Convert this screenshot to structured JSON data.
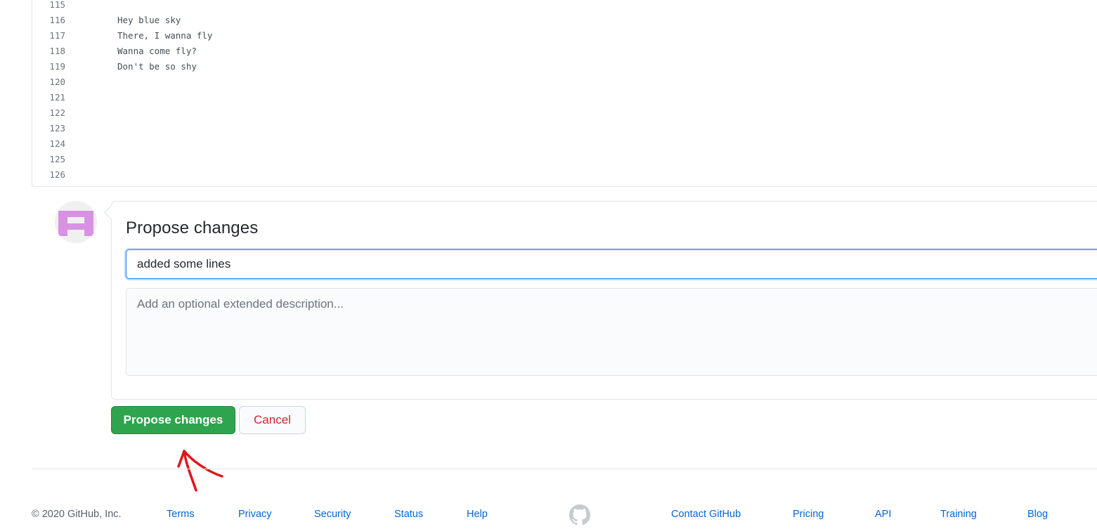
{
  "editor": {
    "lines": [
      {
        "number": "115",
        "text": ""
      },
      {
        "number": "116",
        "text": "Hey blue sky"
      },
      {
        "number": "117",
        "text": "There, I wanna fly"
      },
      {
        "number": "118",
        "text": "Wanna come fly?"
      },
      {
        "number": "119",
        "text": "Don't be so shy"
      },
      {
        "number": "120",
        "text": ""
      },
      {
        "number": "121",
        "text": ""
      },
      {
        "number": "122",
        "text": ""
      },
      {
        "number": "123",
        "text": ""
      },
      {
        "number": "124",
        "text": ""
      },
      {
        "number": "125",
        "text": ""
      },
      {
        "number": "126",
        "text": ""
      }
    ]
  },
  "commit": {
    "avatar_icon": "identicon-avatar",
    "title": "Propose changes",
    "summary_value": "added some lines",
    "description_placeholder": "Add an optional extended description...",
    "submit_label": "Propose changes",
    "cancel_label": "Cancel"
  },
  "annotation": {
    "icon": "red-arrow-annotation-icon",
    "color": "#e0151b"
  },
  "footer": {
    "copyright": "© 2020 GitHub, Inc.",
    "links_left": [
      "Terms",
      "Privacy",
      "Security",
      "Status",
      "Help"
    ],
    "logo_icon": "github-mark-icon",
    "links_right": [
      "Contact GitHub",
      "Pricing",
      "API",
      "Training",
      "Blog"
    ]
  },
  "colors": {
    "primary_button": "#2ea44f",
    "danger_text": "#cb2431",
    "link": "#0366d6",
    "focus_border": "#2188ff",
    "avatar_accent": "#d892e3"
  }
}
